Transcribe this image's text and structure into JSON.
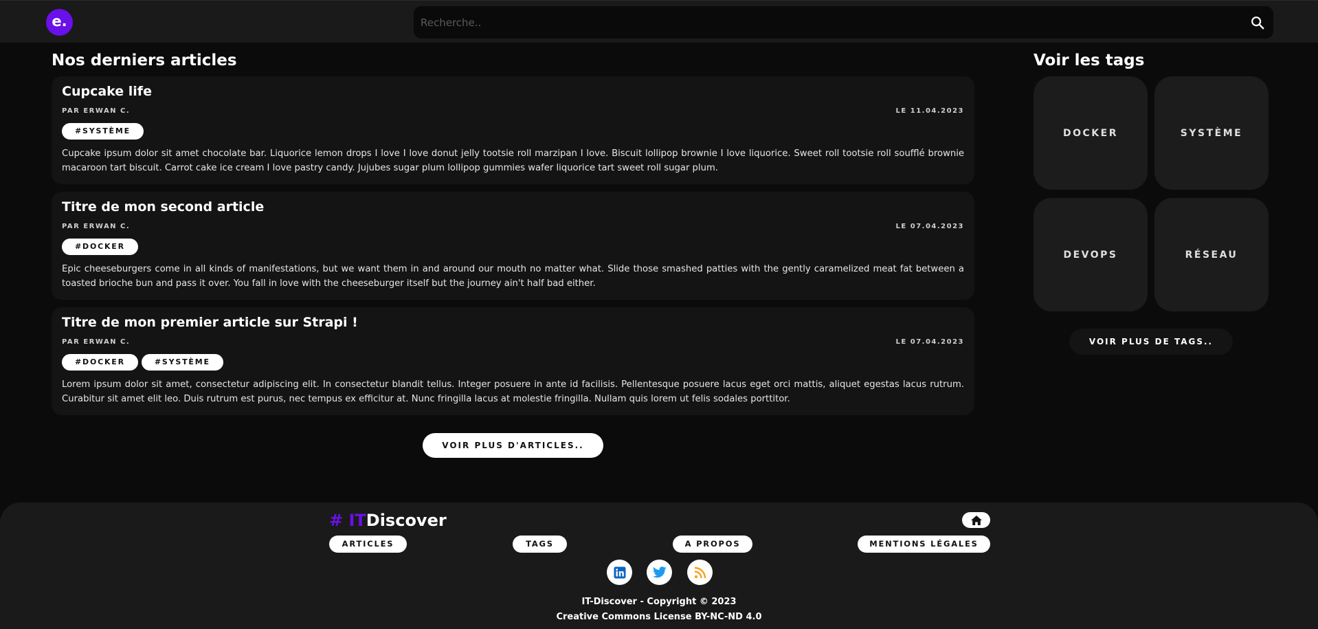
{
  "header": {
    "logo_text": "e.",
    "search_placeholder": "Recherche.."
  },
  "main": {
    "title": "Nos derniers articles",
    "articles": [
      {
        "title": "Cupcake life",
        "author": "PAR ERWAN C.",
        "date": "LE 11.04.2023",
        "tags": [
          "#SYSTÈME"
        ],
        "body": "Cupcake ipsum dolor sit amet chocolate bar. Liquorice lemon drops I love I love donut jelly tootsie roll marzipan I love. Biscuit lollipop brownie I love liquorice. Sweet roll tootsie roll soufflé brownie macaroon tart biscuit. Carrot cake ice cream I love pastry candy. Jujubes sugar plum lollipop gummies wafer liquorice tart sweet roll sugar plum."
      },
      {
        "title": "Titre de mon second article",
        "author": "PAR ERWAN C.",
        "date": "LE 07.04.2023",
        "tags": [
          "#DOCKER"
        ],
        "body": "Epic cheeseburgers come in all kinds of manifestations, but we want them in and around our mouth no matter what. Slide those smashed patties with the gently caramelized meat fat between a toasted brioche bun and pass it over. You fall in love with the cheeseburger itself but the journey ain't half bad either."
      },
      {
        "title": "Titre de mon premier article sur Strapi !",
        "author": "PAR ERWAN C.",
        "date": "LE 07.04.2023",
        "tags": [
          "#DOCKER",
          "#SYSTÈME"
        ],
        "body": "Lorem ipsum dolor sit amet, consectetur adipiscing elit. In consectetur blandit tellus. Integer posuere in ante id facilisis. Pellentesque posuere lacus eget orci mattis, aliquet egestas lacus rutrum. Curabitur sit amet elit leo. Duis rutrum est purus, nec tempus ex efficitur at. Nunc fringilla lacus at molestie fringilla. Nullam quis lorem ut felis sodales porttitor."
      }
    ],
    "more_articles_label": "VOIR PLUS D'ARTICLES.."
  },
  "sidebar": {
    "title": "Voir les tags",
    "tags": [
      "DOCKER",
      "SYSTÈME",
      "DEVOPS",
      "RÉSEAU"
    ],
    "more_tags_label": "VOIR PLUS DE TAGS.."
  },
  "footer": {
    "brand_hash": "# ",
    "brand_it": "IT",
    "brand_rest": "Discover",
    "links": [
      "ARTICLES",
      "TAGS",
      "A PROPOS",
      "MENTIONS LÉGALES"
    ],
    "social_icons": [
      "linkedin-icon",
      "twitter-icon",
      "rss-icon"
    ],
    "copyright": "IT-Discover - Copyright © 2023",
    "license": "Creative Commons License BY-NC-ND 4.0"
  },
  "colors": {
    "accent": "#6a10e8",
    "linkedin": "#0a66c2",
    "twitter": "#1d9bf0",
    "rss": "#f7a21b"
  }
}
